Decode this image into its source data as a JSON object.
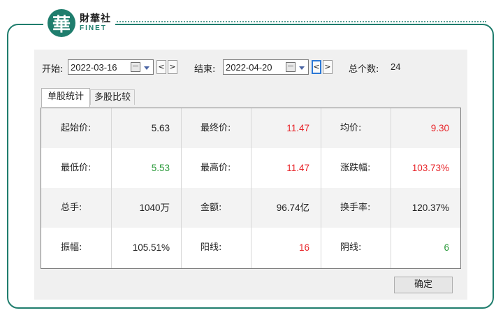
{
  "logo": {
    "mark": "華",
    "cn": "財華社",
    "en": "FINET"
  },
  "toolbar": {
    "start_label": "开始:",
    "start_date": "2022-03-16",
    "end_label": "结束:",
    "end_date": "2022-04-20",
    "prev": "<",
    "next": ">",
    "count_label": "总个数:",
    "count_value": "24"
  },
  "tabs": [
    {
      "label": "单股统计",
      "selected": true
    },
    {
      "label": "多股比较",
      "selected": false
    }
  ],
  "colors": {
    "up": "#e8262b",
    "down": "#2a9a3a",
    "neutral": "#222222",
    "frame": "#1f7d6d"
  },
  "stats": [
    [
      {
        "label": "起始价:",
        "value": "5.63",
        "tone": "neutral"
      },
      {
        "label": "最终价:",
        "value": "11.47",
        "tone": "up"
      },
      {
        "label": "均价:",
        "value": "9.30",
        "tone": "up"
      }
    ],
    [
      {
        "label": "最低价:",
        "value": "5.53",
        "tone": "down"
      },
      {
        "label": "最高价:",
        "value": "11.47",
        "tone": "up"
      },
      {
        "label": "涨跌幅:",
        "value": "103.73%",
        "tone": "up"
      }
    ],
    [
      {
        "label": "总手:",
        "value": "1040万",
        "tone": "neutral"
      },
      {
        "label": "金额:",
        "value": "96.74亿",
        "tone": "neutral"
      },
      {
        "label": "换手率:",
        "value": "120.37%",
        "tone": "neutral"
      }
    ],
    [
      {
        "label": "振幅:",
        "value": "105.51%",
        "tone": "neutral"
      },
      {
        "label": "阳线:",
        "value": "16",
        "tone": "up"
      },
      {
        "label": "阴线:",
        "value": "6",
        "tone": "down"
      }
    ]
  ],
  "ok_label": "确定"
}
